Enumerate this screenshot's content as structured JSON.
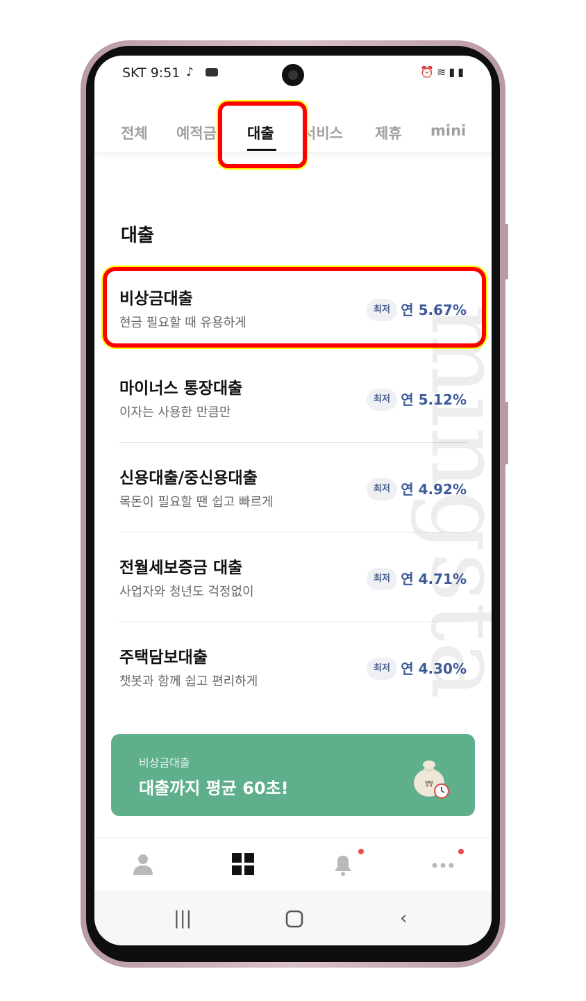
{
  "status_bar": {
    "carrier": "SKT",
    "time": "9:51",
    "icons": [
      "tiktok-icon",
      "voicemail-icon",
      "alarm-icon",
      "wifi-icon",
      "signal-icon",
      "battery-icon"
    ]
  },
  "tabs": [
    {
      "label": "전체",
      "active": false
    },
    {
      "label": "예적금",
      "active": false
    },
    {
      "label": "대출",
      "active": true
    },
    {
      "label": "서비스",
      "active": false
    },
    {
      "label": "제휴",
      "active": false
    },
    {
      "label": "mini",
      "active": false
    }
  ],
  "section_title": "대출",
  "loans": [
    {
      "name": "비상금대출",
      "desc": "현금 필요할 때 유용하게",
      "badge": "최저",
      "rate": "연 5.67%"
    },
    {
      "name": "마이너스 통장대출",
      "desc": "이자는 사용한 만큼만",
      "badge": "최저",
      "rate": "연 5.12%"
    },
    {
      "name": "신용대출/중신용대출",
      "desc": "목돈이 필요할 땐 쉽고 빠르게",
      "badge": "최저",
      "rate": "연 4.92%"
    },
    {
      "name": "전월세보증금 대출",
      "desc": "사업자와 청년도 걱정없이",
      "badge": "최저",
      "rate": "연 4.71%"
    },
    {
      "name": "주택담보대출",
      "desc": "챗봇과 함께 쉽고 편리하게",
      "badge": "최저",
      "rate": "연 4.30%"
    }
  ],
  "banner": {
    "subtitle": "비상금대출",
    "title": "대출까지 평균 60초!",
    "color": "#5faf8d"
  },
  "bottom_nav": [
    "person-icon",
    "grid-icon",
    "bell-icon",
    "more-icon"
  ],
  "watermark": "mingsta"
}
